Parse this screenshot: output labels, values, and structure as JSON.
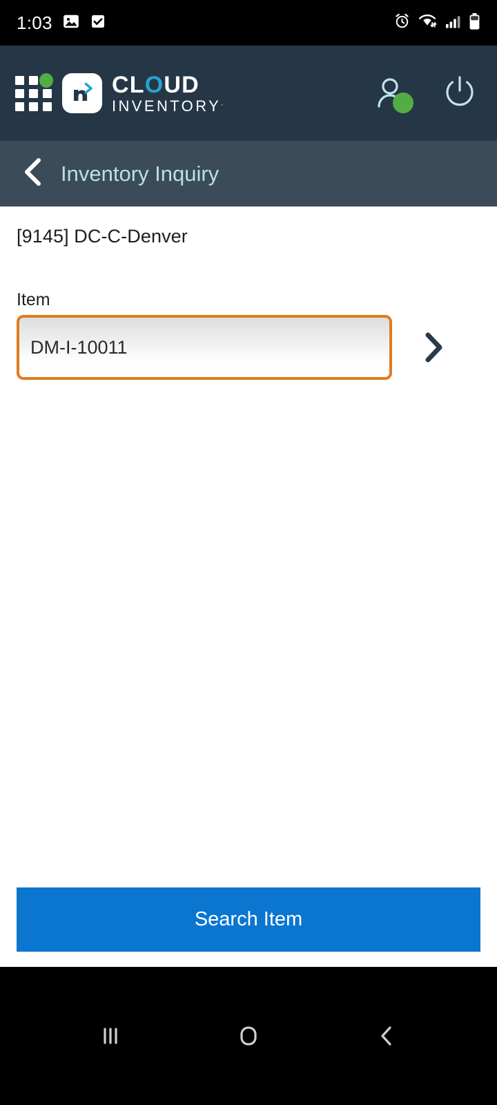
{
  "status_bar": {
    "time": "1:03",
    "left_icons": [
      "image-icon",
      "checkbox-checked-icon"
    ],
    "right_icons": [
      "alarm-icon",
      "wifi-icon",
      "signal-icon",
      "battery-icon"
    ]
  },
  "app_bar": {
    "menu_icon": "grid-menu-icon",
    "logo_letter": "n",
    "brand_line1_pre": "CL",
    "brand_line1_o": "O",
    "brand_line1_post": "UD",
    "brand_line2": "INVENTORY",
    "brand_line2_mark": ".",
    "user_icon": "user-icon",
    "power_icon": "power-icon",
    "background_color": "#253746",
    "accent_green": "#52ae44",
    "accent_teal": "#27a3cf"
  },
  "sub_bar": {
    "back_icon": "chevron-left-icon",
    "title": "Inventory Inquiry",
    "background_color": "#3c4b5a",
    "title_color": "#b8e0e8"
  },
  "content": {
    "location": "[9145] DC-C-Denver",
    "item_label": "Item",
    "item_value": "DM-I-10011",
    "item_placeholder": "",
    "next_icon": "chevron-right-icon",
    "input_border_color": "#e07b1f"
  },
  "footer": {
    "search_button_label": "Search Item",
    "search_button_color": "#0b76d0"
  },
  "nav_bar": {
    "recents_icon": "recents-icon",
    "home_icon": "home-icon",
    "back_icon": "nav-back-icon"
  }
}
